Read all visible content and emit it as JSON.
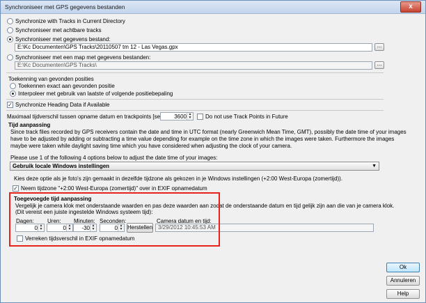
{
  "window": {
    "title": "Synchroniseer met GPS gegevens bestanden",
    "close_label": "x"
  },
  "sync_options": {
    "directory_label": "Synchronize with Tracks in Current Directory",
    "achtbare_label": "Synchroniseer met achtbare tracks",
    "bestand_label": "Synchroniseer met gegevens bestand:",
    "bestand_path": "E:\\Kc Documenten\\GPS Tracks\\20110507 tm 12 - Las Vegas.gpx",
    "map_label": "Synchroniseer met een map met gegevens bestanden:",
    "map_path": "E:\\Kc Documenten\\GPS Tracks\\",
    "browse_label": "..."
  },
  "toekenning": {
    "heading": "Toekenning van gevonden posities",
    "exact_label": "Toekennen exact aan gevonden positie",
    "interpoleer_label": "Interpoleer met gebruik van laatste of volgende positiebepaling"
  },
  "heading_data": {
    "label": "Synchronize Heading Data if Available",
    "checked": true
  },
  "max_tijd": {
    "label": "Maximaal tijdverschil tussen opname datum en trackpoints [seconden]:",
    "value": "3600",
    "no_track_label": "Do not use Track Points in Future"
  },
  "tijd_aanpassing": {
    "heading": "Tijd aanpassing",
    "description_lines": [
      "Since track files recorded by GPS receivers contain the date and time in UTC format (nearly Greenwich Mean Time, GMT), possibly the date time of your images",
      "have to be adjusted by adding or subtracting a time value depending for example on the time zone in which the images were taken. Furthermore the images",
      "maybe were taken while daylight saving time which you have considered when adjusting the clock of your camera."
    ],
    "options_prompt": "Please use 1 of the following 4 options below to adjust the date time of your images:",
    "dropdown_value": "Gebruik locale Windows instellingen",
    "dropdown_arrow": "▼",
    "info_text": "Kies deze optie als je foto's zijn gemaakt in dezelfde tijdzone als gekozen in je Windows instellingen (+2:00 West-Europa (zomertijd)).",
    "neem_label": "Neem tijdzone \"+2:00 West-Europa (zomertijd)\" over in EXIF opnamedatum",
    "neem_checked": true
  },
  "toegevoegde": {
    "heading": "Toegevoegde tijd aanpassing",
    "line1": "Vergelijk je camera klok met onderstaande waarden en pas deze waarden aan zodat de onderstaande datum en tijd gelijk zijn aan die van je camera klok.",
    "line2": "(Dit vereist een juiste ingestelde Windows systeem tijd):",
    "dagen_label": "Dagen:",
    "dagen_value": "0",
    "uren_label": "Uren:",
    "uren_value": "0",
    "minuten_label": "Minuten:",
    "minuten_value": "-30",
    "seconden_label": "Seconden:",
    "seconden_value": "0",
    "herstellen_label": "Herstellen",
    "camera_label": "Camera datum en tijd:",
    "camera_value": "3/29/2012 10:45:53 AM",
    "verreken_label": "Verreken tijdsverschil in EXIF opnamedatum"
  },
  "buttons": {
    "ok": "Ok",
    "annuleren": "Annuleren",
    "help": "Help"
  },
  "colors": {
    "highlight_box": "#e8221b"
  }
}
